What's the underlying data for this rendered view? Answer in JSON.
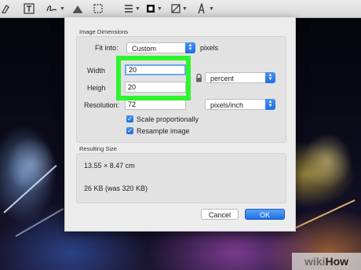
{
  "dialog": {
    "image_dimensions_title": "Image Dimensions",
    "fit_into_label": "Fit into:",
    "fit_into_value": "Custom",
    "fit_into_unit": "pixels",
    "width_label": "Width",
    "width_value": "20",
    "height_label": "Heigh",
    "height_value": "20",
    "unit_value": "percent",
    "resolution_label": "Resolution:",
    "resolution_value": "72",
    "resolution_unit": "pixels/inch",
    "scale_proportionally": "Scale proportionally",
    "resample_image": "Resample image",
    "resulting_size_title": "Resulting Size",
    "dimensions_result": "13.55 × 8.47 cm",
    "filesize_result": "26 KB (was 320 KB)",
    "cancel_label": "Cancel",
    "ok_label": "OK"
  },
  "toolbar": {
    "icons": [
      "text-box-icon",
      "signature-icon",
      "adjust-color-icon",
      "crop-icon",
      "shape-style-icon",
      "border-color-icon",
      "fill-color-icon",
      "font-icon"
    ]
  },
  "watermark": {
    "prefix": "wiki",
    "suffix": "How"
  },
  "colors": {
    "highlight": "#2ef52e",
    "accent": "#1f6fe0"
  }
}
